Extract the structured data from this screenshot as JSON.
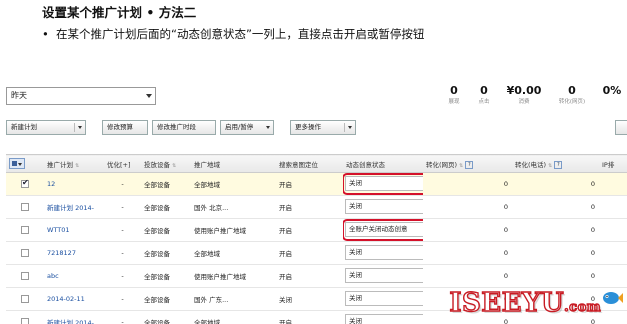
{
  "slide": {
    "title": "设置某个推广计划 • 方法二",
    "bullet_mark": "•",
    "bullet": "在某个推广计划后面的“动态创意状态”一列上，直接点击开启或暂停按钮"
  },
  "date_select": {
    "value": "昨天"
  },
  "stats": [
    {
      "value": "0",
      "label": "展现"
    },
    {
      "value": "0",
      "label": "点击"
    },
    {
      "value": "¥0.00",
      "label": "消费"
    },
    {
      "value": "0",
      "label": "转化(网页)"
    },
    {
      "value": "0%",
      "label": ""
    }
  ],
  "toolbar": {
    "new_plan": "新建计划",
    "edit_budget": "修改预算",
    "edit_schedule": "修改推广时段",
    "enable_pause": "启用/暂停",
    "more_ops": "更多操作"
  },
  "table": {
    "columns": [
      "推广计划",
      "优化[+]",
      "投放设备",
      "推广地域",
      "搜索意图定位",
      "动态创意状态",
      "转化(网页)",
      "转化(电话)",
      "IP排"
    ],
    "rows": [
      {
        "checked": true,
        "plan": "12",
        "opt": "-",
        "device": "全部设备",
        "region": "全部地域",
        "intent": "开启",
        "status": "关闭",
        "toggle": "play",
        "conv_web": "0",
        "conv_tel": "0"
      },
      {
        "checked": false,
        "plan": "新建计划 2014-",
        "opt": "-",
        "device": "全部设备",
        "region": "国外 北京...",
        "intent": "开启",
        "status": "关闭",
        "toggle": "",
        "conv_web": "0",
        "conv_tel": "0"
      },
      {
        "checked": false,
        "plan": "WTT01",
        "opt": "-",
        "device": "全部设备",
        "region": "使用账户推广地域",
        "intent": "开启",
        "status": "全账户关闭动态创意",
        "toggle": "pause",
        "conv_web": "0",
        "conv_tel": "0"
      },
      {
        "checked": false,
        "plan": "7218127",
        "opt": "-",
        "device": "全部设备",
        "region": "全部地域",
        "intent": "开启",
        "status": "关闭",
        "toggle": "",
        "conv_web": "0",
        "conv_tel": "0"
      },
      {
        "checked": false,
        "plan": "abc",
        "opt": "-",
        "device": "全部设备",
        "region": "使用账户推广地域",
        "intent": "开启",
        "status": "关闭",
        "toggle": "",
        "conv_web": "0",
        "conv_tel": "0"
      },
      {
        "checked": false,
        "plan": "2014-02-11",
        "opt": "-",
        "device": "全部设备",
        "region": "国外 广东...",
        "intent": "关闭",
        "status": "关闭",
        "toggle": "",
        "conv_web": "0",
        "conv_tel": "0"
      },
      {
        "checked": false,
        "plan": "新建计划 2014-",
        "opt": "-",
        "device": "全部设备",
        "region": "全部地域",
        "intent": "开启",
        "status": "关闭",
        "toggle": "",
        "conv_web": "0",
        "conv_tel": "0"
      }
    ]
  },
  "watermark": {
    "text": "ISEEYU",
    "tld": ".com"
  },
  "colors": {
    "highlight_frame": "#d4112a",
    "link": "#1a4fa0",
    "row_highlight": "#fffbe0"
  }
}
